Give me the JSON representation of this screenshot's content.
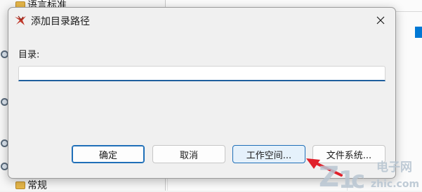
{
  "background": {
    "tree_items": [
      {
        "label": "语言标准"
      },
      {
        "label": "常规"
      }
    ]
  },
  "dialog": {
    "title": "添加目录路径",
    "directory_label": "目录:",
    "directory_value": "",
    "buttons": {
      "ok": "确定",
      "cancel": "取消",
      "workspace": "工作空间...",
      "filesystem": "文件系统..."
    }
  },
  "watermark": {
    "text": "电子网",
    "domain": "zhic.com"
  },
  "colors": {
    "accent": "#1f6fb8",
    "input_underline": "#1f5f9e",
    "annotation_arrow": "#e0202a",
    "watermark": "#b9c6d2"
  }
}
